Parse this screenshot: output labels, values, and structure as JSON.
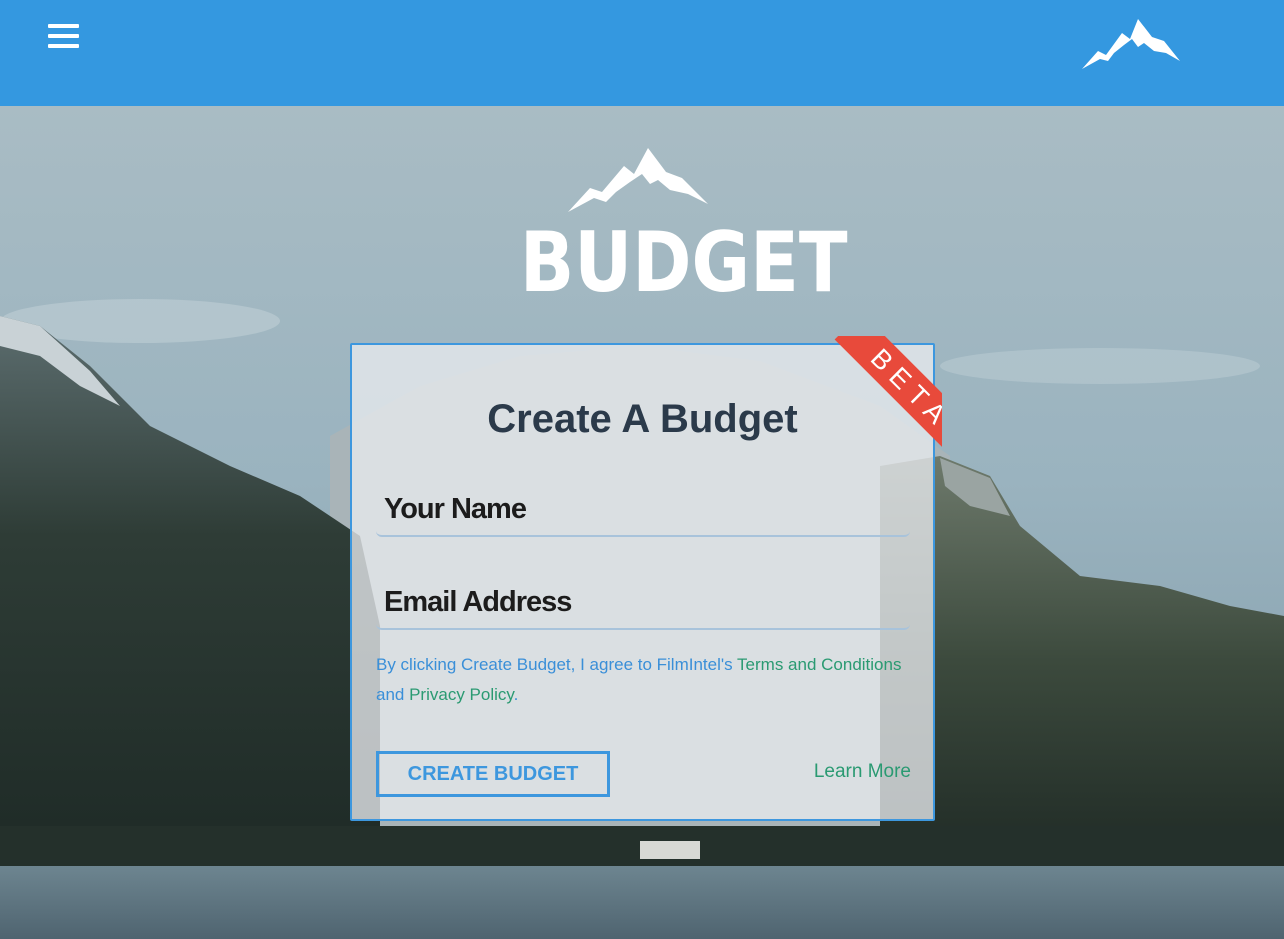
{
  "header": {
    "menu_icon": "hamburger-menu-icon",
    "logo_icon": "mountain-logo-icon"
  },
  "brand": {
    "logo_icon": "mountain-logo-icon",
    "wordmark": "BUDGET"
  },
  "form": {
    "ribbon": "BETA",
    "title": "Create A Budget",
    "name_placeholder": "Your Name",
    "email_placeholder": "Email Address",
    "terms_prefix": "By clicking Create Budget, I agree to FilmIntel's ",
    "terms_link": "Terms and Conditions",
    "terms_and": " and ",
    "privacy_link": "Privacy Policy",
    "terms_suffix": ".",
    "submit_label": "CREATE BUDGET",
    "learn_more": "Learn More"
  },
  "colors": {
    "header_bg": "#3498e0",
    "accent_blue": "#3d97de",
    "link_green": "#2a9a72",
    "ribbon_red": "#e84a3b"
  }
}
